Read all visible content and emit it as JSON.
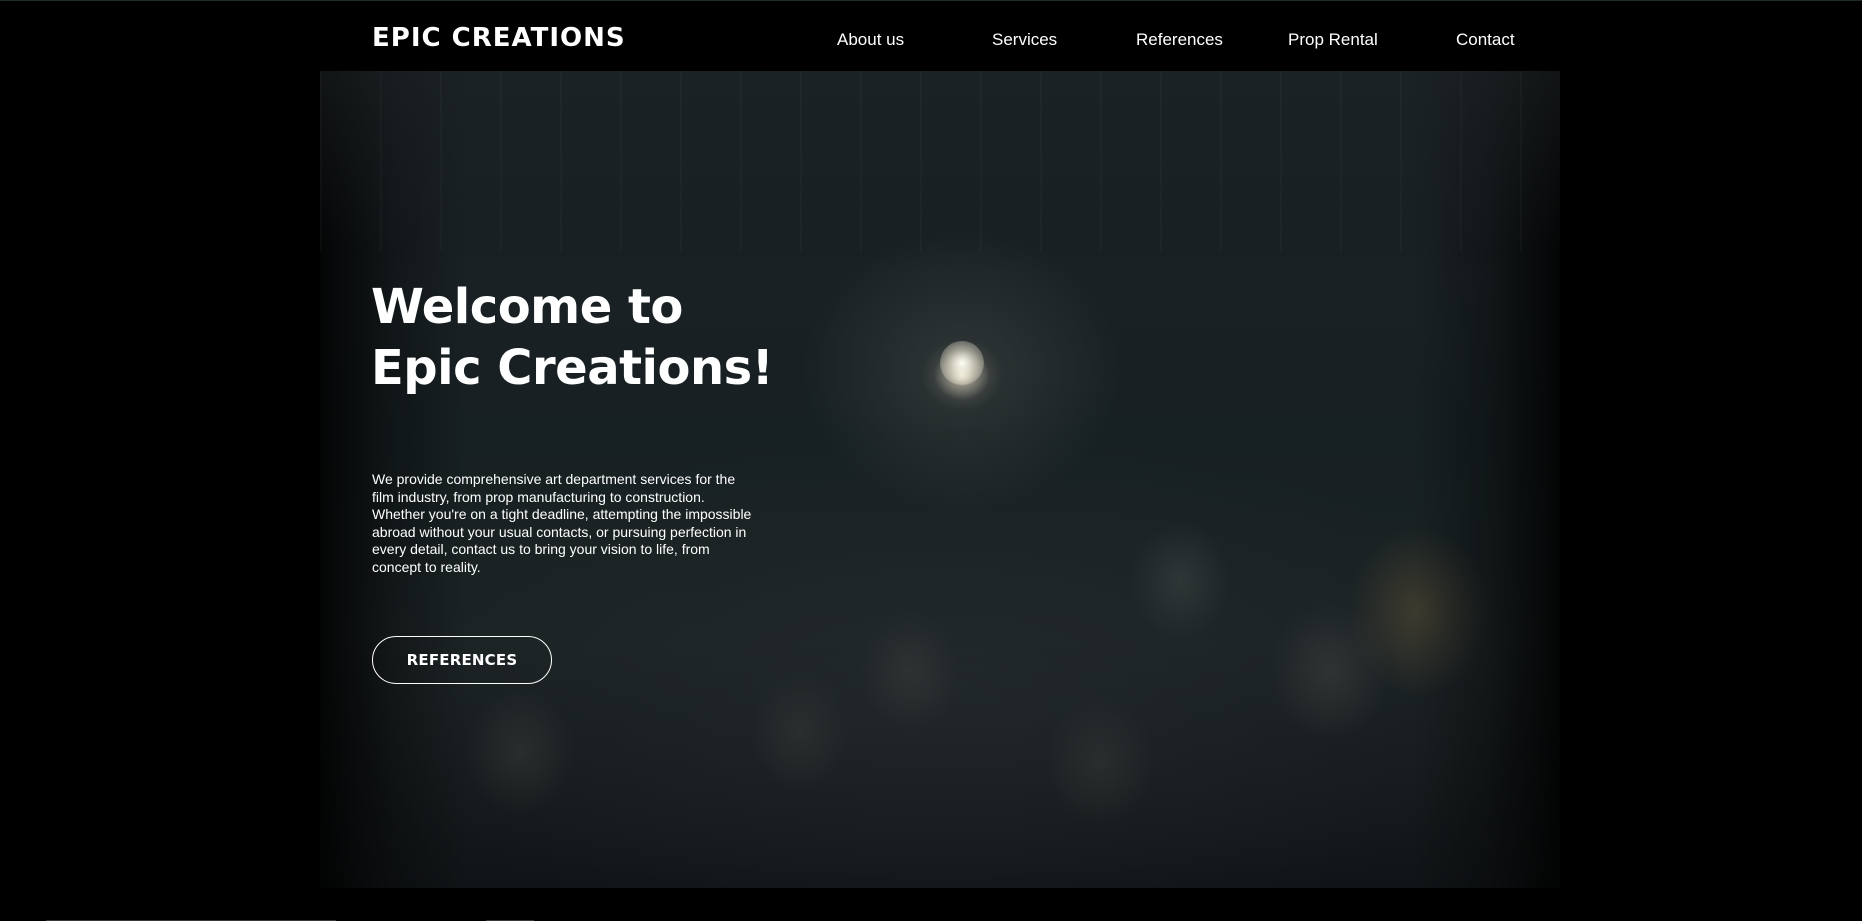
{
  "header": {
    "logo": "EPIC CREATIONS",
    "nav": {
      "about": "About us",
      "services": "Services",
      "references": "References",
      "prop_rental": "Prop Rental",
      "contact": "Contact"
    }
  },
  "hero": {
    "title_line1": "Welcome to",
    "title_line2": "Epic Creations!",
    "description": "We provide comprehensive art department services for the film industry, from prop manufacturing to construction. Whether you're on a tight deadline, attempting the impossible abroad without your usual contacts, or pursuing perfection in every detail, contact us to bring your vision to life, from concept to reality.",
    "button_label": "REFERENCES"
  },
  "colors": {
    "background": "#000000",
    "text": "#ffffff"
  }
}
